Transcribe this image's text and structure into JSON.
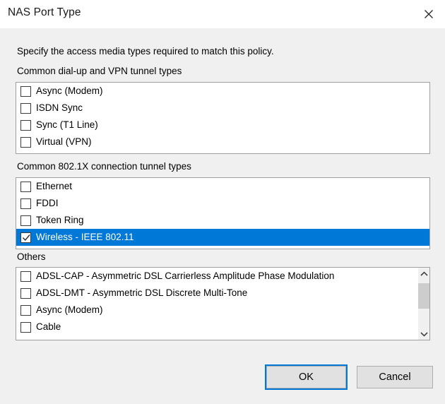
{
  "window": {
    "title": "NAS Port Type",
    "close_icon": "close-icon"
  },
  "body": {
    "description": "Specify the access media types required to match this policy."
  },
  "groups": [
    {
      "label": "Common dial-up and VPN tunnel types",
      "items": [
        {
          "label": "Async (Modem)",
          "checked": false,
          "selected": false
        },
        {
          "label": "ISDN Sync",
          "checked": false,
          "selected": false
        },
        {
          "label": "Sync (T1 Line)",
          "checked": false,
          "selected": false
        },
        {
          "label": "Virtual (VPN)",
          "checked": false,
          "selected": false
        }
      ]
    },
    {
      "label": "Common 802.1X connection tunnel types",
      "items": [
        {
          "label": "Ethernet",
          "checked": false,
          "selected": false
        },
        {
          "label": "FDDI",
          "checked": false,
          "selected": false
        },
        {
          "label": "Token Ring",
          "checked": false,
          "selected": false
        },
        {
          "label": "Wireless - IEEE 802.11",
          "checked": true,
          "selected": true
        }
      ]
    },
    {
      "label": "Others",
      "items": [
        {
          "label": "ADSL-CAP - Asymmetric DSL Carrierless Amplitude Phase Modulation",
          "checked": false,
          "selected": false
        },
        {
          "label": "ADSL-DMT - Asymmetric DSL Discrete Multi-Tone",
          "checked": false,
          "selected": false
        },
        {
          "label": "Async (Modem)",
          "checked": false,
          "selected": false
        },
        {
          "label": "Cable",
          "checked": false,
          "selected": false
        }
      ]
    }
  ],
  "scrollbar": {
    "up_icon": "chevron-up-icon",
    "down_icon": "chevron-down-icon"
  },
  "footer": {
    "ok_label": "OK",
    "cancel_label": "Cancel"
  },
  "colors": {
    "accent": "#0078d7",
    "dialog_bg": "#f0f0f0",
    "list_bg": "#ffffff",
    "button_bg": "#e1e1e1",
    "scroll_thumb": "#cdcdcd"
  }
}
